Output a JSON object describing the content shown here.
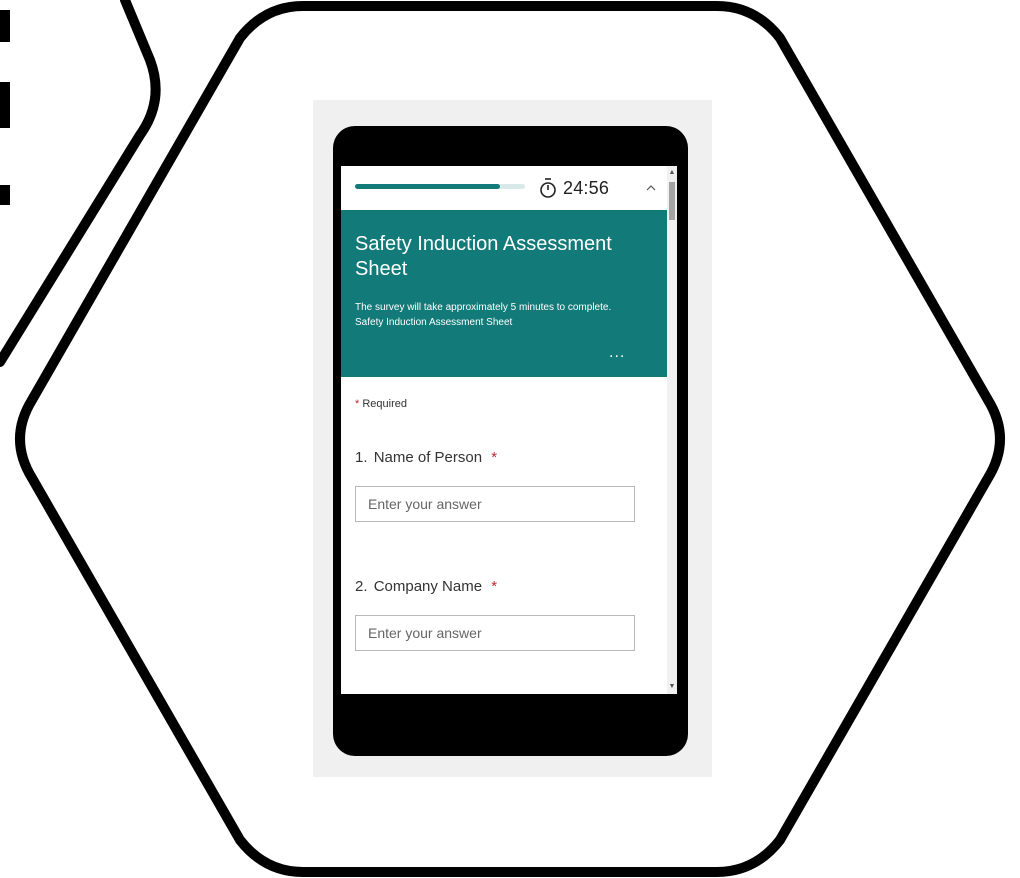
{
  "form": {
    "timer": "24:56",
    "progress": 0.85,
    "title": "Safety Induction Assessment Sheet",
    "description": "The survey will take approximately 5 minutes to complete. Safety Induction Assessment Sheet",
    "more_label": "...",
    "required_star": "*",
    "required_label": "Required",
    "questions": [
      {
        "number": "1.",
        "label": "Name of Person",
        "star": "*",
        "placeholder": "Enter your answer"
      },
      {
        "number": "2.",
        "label": "Company Name",
        "star": "*",
        "placeholder": "Enter your answer"
      }
    ]
  },
  "colors": {
    "accent": "#127a78",
    "required_star": "#c4262e",
    "phone_frame": "#000000",
    "outline": "#000000"
  }
}
